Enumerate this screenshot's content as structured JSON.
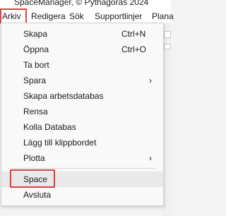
{
  "window": {
    "title": "SpaceManager, © Pythagoras 2024"
  },
  "menubar": {
    "items": [
      {
        "label": "Arkiv"
      },
      {
        "label": "Redigera"
      },
      {
        "label": "Sök"
      },
      {
        "label": "Supportlinjer"
      },
      {
        "label": "Plana"
      }
    ]
  },
  "menu": {
    "items": [
      {
        "label": "Skapa",
        "shortcut": "Ctrl+N"
      },
      {
        "label": "Öppna",
        "shortcut": "Ctrl+O"
      },
      {
        "label": "Ta bort"
      },
      {
        "label": "Spara",
        "arrow": "›"
      },
      {
        "label": "Skapa arbetsdatabas"
      },
      {
        "label": "Rensa"
      },
      {
        "label": "Kolla Databas"
      },
      {
        "label": "Lägg till klippbordet"
      },
      {
        "label": "Plotta",
        "arrow": "›"
      },
      {
        "label": "Space"
      },
      {
        "label": "Avsluta"
      }
    ]
  },
  "colors": {
    "highlight": "#e04040",
    "menu_bg": "#f9f9f9",
    "selected_bg": "#e9e9e9"
  }
}
